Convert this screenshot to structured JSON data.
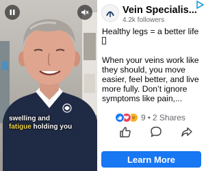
{
  "video": {
    "caption_line1": "swelling and",
    "caption_highlight": "fatigue",
    "caption_line2_rest": " holding you",
    "pause_icon": "pause-icon",
    "mute_icon": "muted-speaker-icon"
  },
  "page": {
    "name": "Vein Specialis...",
    "followers": "4.2k followers",
    "logo_icon": "vein-logo-icon"
  },
  "post": {
    "line1": "Healthy legs = a better life",
    "line2": "When your veins work like they should, you move easier, feel better, and live more fully. Don’t ignore symptoms like pain,..."
  },
  "engagement": {
    "reaction_icons": [
      "like-icon",
      "love-icon",
      "haha-icon"
    ],
    "reaction_count": "9",
    "separator": "•",
    "shares": "2 Shares"
  },
  "actions": {
    "like_icon": "thumbs-up-icon",
    "comment_icon": "comment-icon",
    "share_icon": "share-icon"
  },
  "cta": {
    "label": "Learn More"
  },
  "colors": {
    "brand": "#1877f2",
    "caption_accent": "#f2d94e",
    "text": "#050505",
    "muted": "#65676b"
  }
}
